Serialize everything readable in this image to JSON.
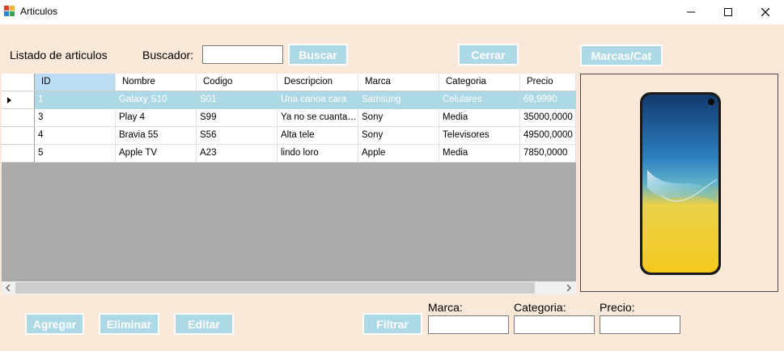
{
  "window": {
    "title": "Articulos",
    "icon": "app-window-icon",
    "controls": [
      "minimize-icon",
      "maximize-icon",
      "close-icon"
    ]
  },
  "header": {
    "list_title": "Listado de articulos",
    "search_label": "Buscador:",
    "search_value": "",
    "search_button": "Buscar",
    "close_button": "Cerrar",
    "brands_button": "Marcas/Cat"
  },
  "grid": {
    "columns": [
      "ID",
      "Nombre",
      "Codigo",
      "Descripcion",
      "Marca",
      "Categoria",
      "Precio"
    ],
    "rows": [
      [
        "1",
        "Galaxy S10",
        "S01",
        "Una canoa cara",
        "Samsung",
        "Celulares",
        "69,9990"
      ],
      [
        "3",
        "Play 4",
        "S99",
        "Ya no se cuantas...",
        "Sony",
        "Media",
        "35000,0000"
      ],
      [
        "4",
        "Bravia 55",
        "S56",
        "Alta tele",
        "Sony",
        "Televisores",
        "49500,0000"
      ],
      [
        "5",
        "Apple TV",
        "A23",
        "lindo loro",
        "Apple",
        "Media",
        "7850,0000"
      ]
    ],
    "selected_row": 0,
    "selected_column": 0,
    "row_indicator": "current-row-arrow-icon"
  },
  "preview": {
    "image": "smartphone-image"
  },
  "footer": {
    "add_button": "Agregar",
    "delete_button": "Eliminar",
    "edit_button": "Editar",
    "filter_button": "Filtrar",
    "brand_label": "Marca:",
    "brand_value": "",
    "category_label": "Categoria:",
    "category_value": "",
    "price_label": "Precio:",
    "price_value": ""
  },
  "colors": {
    "form_background": "#fae9d8",
    "button_background": "#add8e6",
    "selection": "#add8e6"
  }
}
